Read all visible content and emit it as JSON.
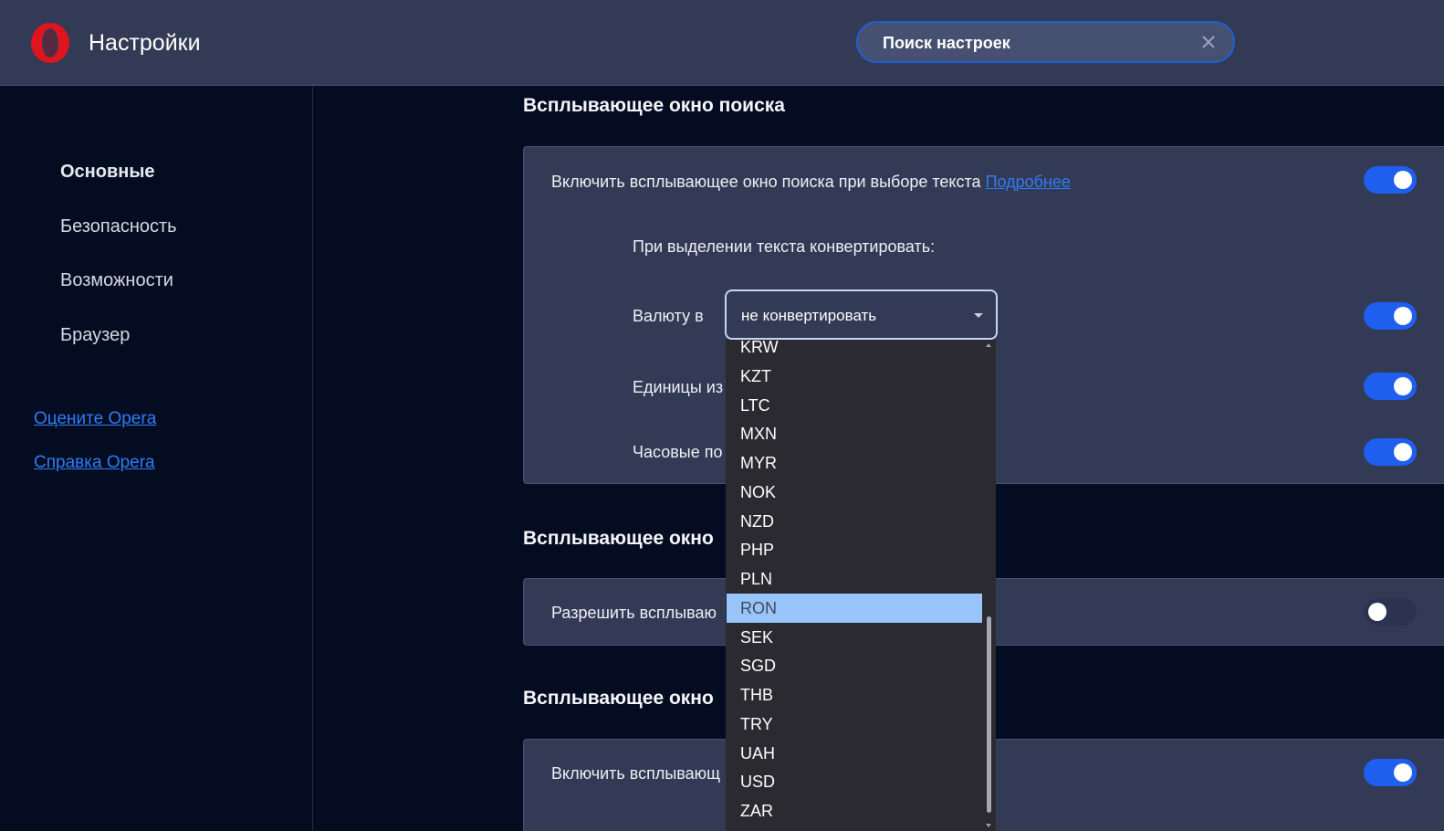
{
  "header": {
    "title": "Настройки",
    "logo": "opera-logo",
    "search": {
      "placeholder": "Поиск настроек",
      "value": "",
      "clear_icon": "close-icon"
    }
  },
  "sidebar": {
    "items": [
      {
        "label": "Основные",
        "active": true
      },
      {
        "label": "Безопасность",
        "active": false
      },
      {
        "label": "Возможности",
        "active": false
      },
      {
        "label": "Браузер",
        "active": false
      }
    ],
    "links": [
      {
        "label": "Оцените Opera"
      },
      {
        "label": "Справка Opera"
      }
    ]
  },
  "main": {
    "section1": {
      "title": "Всплывающее окно поиска",
      "enable_label": "Включить всплывающее окно поиска при выборе текста",
      "more_link": "Подробнее",
      "enable_on": true,
      "convert_heading": "При выделении текста конвертировать:",
      "currency": {
        "label": "Валюту в",
        "selected": "не конвертировать",
        "toggle_on": true,
        "options": [
          "KRW",
          "KZT",
          "LTC",
          "MXN",
          "MYR",
          "NOK",
          "NZD",
          "PHP",
          "PLN",
          "RON",
          "SEK",
          "SGD",
          "THB",
          "TRY",
          "UAH",
          "USD",
          "ZAR"
        ],
        "highlighted": "RON"
      },
      "units": {
        "label": "Единицы из",
        "toggle_on": true
      },
      "timezones": {
        "label": "Часовые по",
        "toggle_on": true
      }
    },
    "section2": {
      "title": "Всплывающее окно",
      "allow_label": "Разрешить всплываю",
      "allow_on": false
    },
    "section3": {
      "title": "Всплывающее окно",
      "enable_label": "Включить всплывающ",
      "enable_on": true
    }
  },
  "colors": {
    "accent": "#1e5ff0",
    "header_bg": "#333a55",
    "page_bg": "#040c22",
    "link": "#2e7df5",
    "option_highlight": "#97c4fb"
  }
}
